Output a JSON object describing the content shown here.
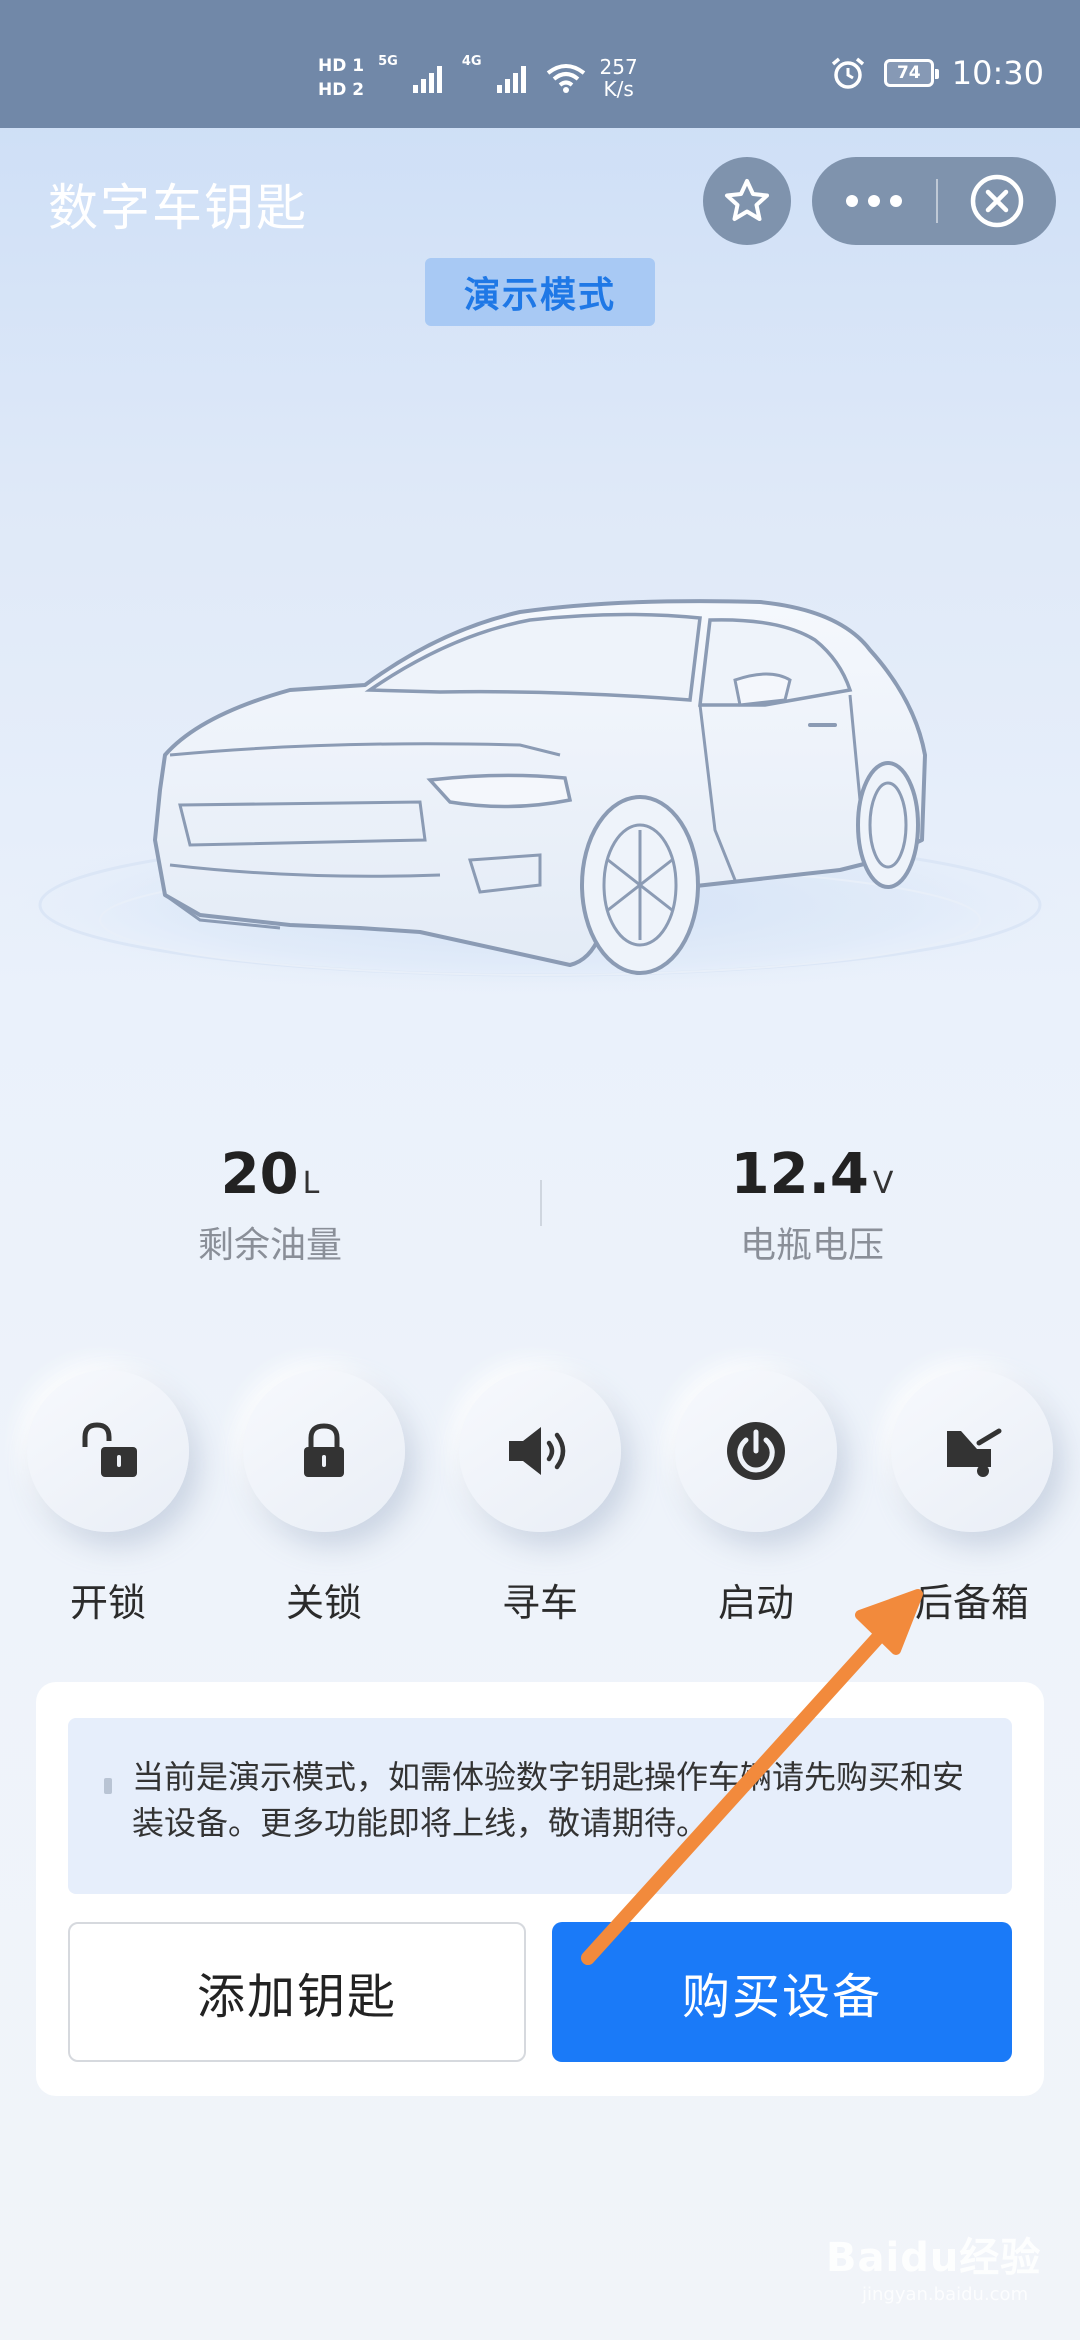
{
  "status_bar": {
    "hd1": "HD 1",
    "hd2": "HD 2",
    "net1": "5G",
    "net2": "4G",
    "speed_value": "257",
    "speed_unit": "K/s",
    "battery": "74",
    "time": "10:30",
    "icons": [
      "signal-icon",
      "wifi-icon",
      "alarm-icon",
      "battery-icon"
    ]
  },
  "header": {
    "title": "数字车钥匙",
    "badge": "演示模式"
  },
  "stats": [
    {
      "value": "20",
      "unit": "L",
      "label": "剩余油量"
    },
    {
      "value": "12.4",
      "unit": "V",
      "label": "电瓶电压"
    }
  ],
  "actions": [
    {
      "label": "开锁",
      "icon": "unlock-icon"
    },
    {
      "label": "关锁",
      "icon": "lock-icon"
    },
    {
      "label": "寻车",
      "icon": "speaker-icon"
    },
    {
      "label": "启动",
      "icon": "power-icon"
    },
    {
      "label": "后备箱",
      "icon": "trunk-icon"
    }
  ],
  "notice": {
    "text": "当前是演示模式，如需体验数字钥匙操作车辆请先购买和安装设备。更多功能即将上线，敬请期待。"
  },
  "buttons": {
    "add_key": "添加钥匙",
    "buy_device": "购买设备"
  },
  "watermark": {
    "text": "Baidu经验",
    "sub": "jingyan.baidu.com"
  },
  "colors": {
    "accent": "#1a7af8",
    "status_bar": "#7188a8",
    "arrow": "#f28a3c"
  }
}
